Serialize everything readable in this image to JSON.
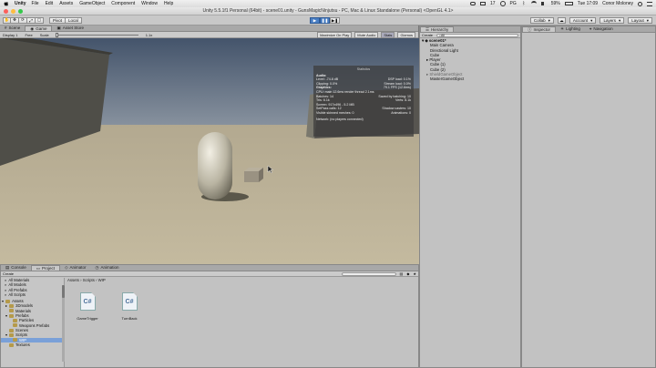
{
  "menubar": {
    "app": "Unity",
    "items": [
      "File",
      "Edit",
      "Assets",
      "GameObject",
      "Component",
      "Window",
      "Help"
    ],
    "status": [
      "17",
      "PG",
      "59%"
    ],
    "clock": "Tue 17:09",
    "user": "Conor Moloney"
  },
  "window": {
    "title": "Unity 5.5.1f1 Personal (64bit) - scene01.unity - GunsMagicNinjutsu - PC, Mac & Linux Standalone (Personal) <OpenGL 4.1>"
  },
  "toolbar": {
    "pivot": "Pivot",
    "local": "Local",
    "collab": "Collab",
    "account": "Account",
    "layers": "Layers",
    "layout": "Layout"
  },
  "scene_tabs": {
    "scene": "Scene",
    "game": "Game",
    "asset_store": "Asset Store"
  },
  "game_bar": {
    "display": "Display 1",
    "aspect": "Free",
    "scale_label": "Scale",
    "scale_value": "1.1x",
    "maximize": "Maximize On Play",
    "mute": "Mute Audio",
    "stats": "Stats",
    "gizmos": "Gizmos"
  },
  "stats": {
    "title": "Statistics",
    "audio_header": "Audio:",
    "level": "Level: -74.8 dB",
    "clipping": "Clipping: 0.0%",
    "dsp": "DSP load: 0.1%",
    "stream": "Stream load: 0.0%",
    "graphics_header": "Graphics:",
    "fps": "79.1 FPS (12.6ms)",
    "cpu": "CPU: main 12.6ms  render thread 2.1ms",
    "batches": "Batches: 14",
    "saved": "Saved by batching: 10",
    "tris": "Tris: 6.1k",
    "verts": "Verts: 8.1k",
    "screen": "Screen: 917x496 - 5.2 MB",
    "setpass": "SetPass calls: 12",
    "shadow": "Shadow casters: 10",
    "skinned": "Visible skinned meshes: 0",
    "animations": "Animations: 0",
    "network": "Network: (no players connected)"
  },
  "hierarchy": {
    "tab": "Hierarchy",
    "create": "Create",
    "search_placeholder": "All",
    "scene": "scene01*",
    "items": [
      "Main Camera",
      "Directional Light",
      "Cube",
      "Player",
      "Cube (1)",
      "Cube (2)",
      "ShieldGameObject",
      "MasterGameObject"
    ]
  },
  "inspector": {
    "tab": "Inspector",
    "lighting": "Lighting",
    "navigation": "Navigation"
  },
  "project": {
    "tabs": {
      "console": "Console",
      "project": "Project",
      "animator": "Animator",
      "animation": "Animation"
    },
    "create": "Create",
    "breadcrumb": "Assets › Scripts › WIP",
    "tree": [
      "All Materials",
      "All Models",
      "All Prefabs",
      "All Scripts",
      "Assets",
      "3Dmodels",
      "Materials",
      "Prefabs",
      "Particles",
      "Weapons Prefabs",
      "Scenes",
      "Scripts",
      "WIP",
      "Textures"
    ],
    "files": [
      "GameTrigger",
      "TurnBack"
    ]
  },
  "colors": {
    "play_active": "#4a7fc4",
    "sky": "#4a5a72",
    "floor": "#bfb49a",
    "wall": "#56544c"
  }
}
